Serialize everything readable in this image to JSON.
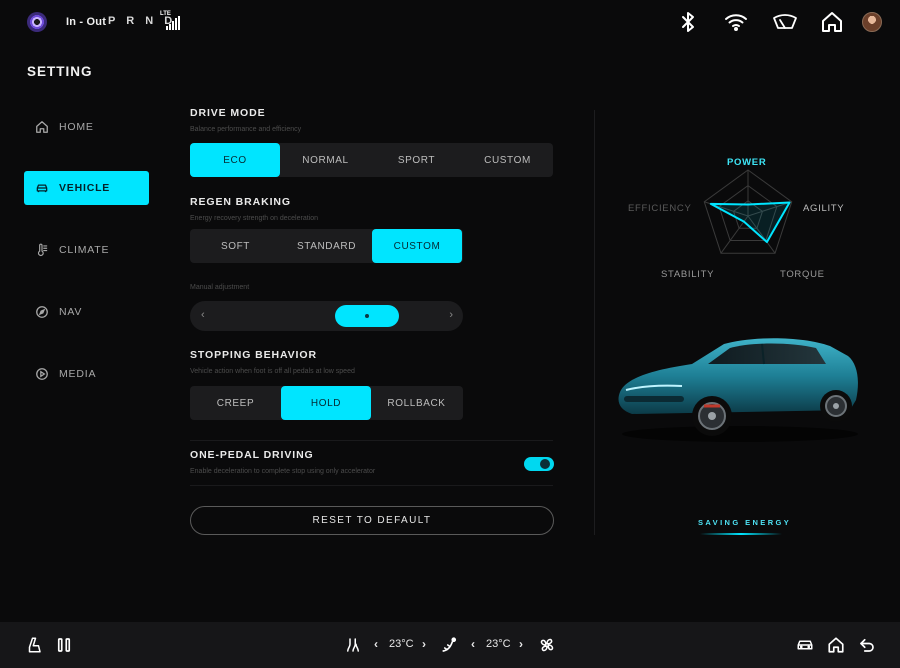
{
  "status": {
    "gear_label": "In - Out",
    "prnd": "P R N D",
    "network": "LTE",
    "icons": [
      "bluetooth-icon",
      "wifi-icon",
      "wiper-icon",
      "home-icon",
      "avatar"
    ]
  },
  "page_title": "SETTING",
  "sidebar": {
    "items": [
      {
        "label": "HOME",
        "icon": "home-icon",
        "active": false
      },
      {
        "label": "VEHICLE",
        "icon": "car-icon",
        "active": true
      },
      {
        "label": "CLIMATE",
        "icon": "thermometer-icon",
        "active": false
      },
      {
        "label": "NAV",
        "icon": "compass-icon",
        "active": false
      },
      {
        "label": "MEDIA",
        "icon": "play-icon",
        "active": false
      }
    ]
  },
  "drive_mode": {
    "title": "DRIVE MODE",
    "subtitle": "Balance performance and efficiency",
    "options": [
      "ECO",
      "NORMAL",
      "SPORT",
      "CUSTOM"
    ],
    "selected": "ECO"
  },
  "regen_braking": {
    "title": "REGEN BRAKING",
    "subtitle": "Energy recovery strength on deceleration",
    "options": [
      "SOFT",
      "STANDARD",
      "CUSTOM"
    ],
    "selected": "CUSTOM",
    "manual_label": "Manual adjustment",
    "manual_level": 0.7
  },
  "stopping": {
    "title": "STOPPING BEHAVIOR",
    "subtitle": "Vehicle action when foot is off all pedals at low speed",
    "options": [
      "CREEP",
      "HOLD",
      "ROLLBACK"
    ],
    "selected": "HOLD"
  },
  "one_pedal": {
    "title": "ONE-PEDAL DRIVING",
    "subtitle": "Enable deceleration to complete stop using only accelerator",
    "enabled": true
  },
  "reset_label": "RESET TO DEFAULT",
  "radar": {
    "labels": {
      "power": "POWER",
      "agility": "AGILITY",
      "torque": "TORQUE",
      "stability": "STABILITY",
      "efficiency": "EFFICIENCY"
    },
    "values": {
      "power": 0.25,
      "agility": 0.95,
      "torque": 0.7,
      "stability": 0.15,
      "efficiency": 0.85
    },
    "highlight": [
      "power",
      "agility"
    ],
    "accent": "#00e5ff"
  },
  "saving_label": "SAVING ENERGY",
  "bottom": {
    "left_temp": "23°C",
    "right_temp": "23°C",
    "icons": [
      "seat-icon",
      "pause-icon",
      "heated-seat-icon",
      "airflow-icon",
      "fan-icon",
      "car-icon",
      "home-icon",
      "back-icon"
    ]
  },
  "colors": {
    "accent": "#00e5ff",
    "background": "#0a0a0b"
  }
}
